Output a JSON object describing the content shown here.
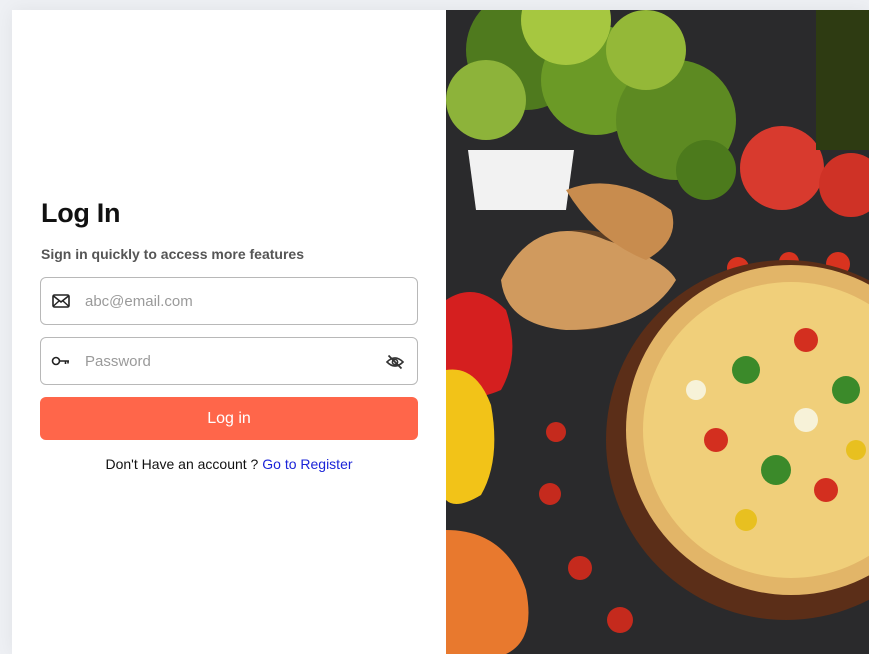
{
  "login": {
    "title": "Log In",
    "subtitle": "Sign in quickly to access more features",
    "email_placeholder": "abc@email.com",
    "password_placeholder": "Password",
    "submit_label": "Log in",
    "register_prompt": "Don't Have an account ? ",
    "register_link": "Go to Register"
  },
  "icons": {
    "email": "envelope-icon",
    "password": "key-icon",
    "toggle": "eye-slash-icon"
  },
  "colors": {
    "accent": "#ff664a",
    "link": "#1b24d8"
  }
}
